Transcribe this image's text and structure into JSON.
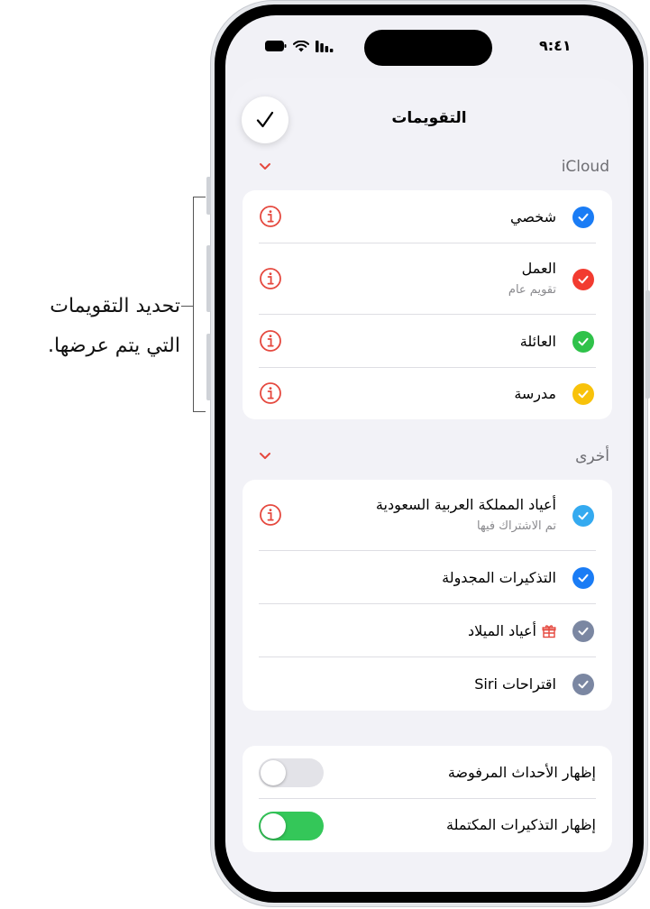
{
  "callout": {
    "line1": "تحديد التقويمات",
    "line2": "التي يتم عرضها."
  },
  "status_bar": {
    "time": "٩:٤١"
  },
  "sheet": {
    "title": "التقويمات",
    "done_icon": "checkmark-icon"
  },
  "sections": [
    {
      "header": "iCloud",
      "items": [
        {
          "title": "شخصي",
          "subtitle": "",
          "color": "#1a7cf5"
        },
        {
          "title": "العمل",
          "subtitle": "تقويم عام",
          "color": "#f23b30"
        },
        {
          "title": "العائلة",
          "subtitle": "",
          "color": "#2fc24a"
        },
        {
          "title": "مدرسة",
          "subtitle": "",
          "color": "#f8c20a"
        }
      ]
    },
    {
      "header": "أخرى",
      "items": [
        {
          "title": "أعياد المملكة العربية السعودية",
          "subtitle": "تم الاشتراك فيها",
          "color": "#34aaf0"
        },
        {
          "title": "التذكيرات المجدولة",
          "subtitle": "",
          "color": "#1a7cf5"
        },
        {
          "title": "أعياد الميلاد",
          "subtitle": "",
          "color": "#7b87a2"
        },
        {
          "title": "اقتراحات Siri",
          "subtitle": "",
          "color": "#7b87a2"
        }
      ]
    }
  ],
  "toggles": [
    {
      "label": "إظهار الأحداث المرفوضة",
      "on": false
    },
    {
      "label": "إظهار التذكيرات المكتملة",
      "on": true
    }
  ],
  "colors": {
    "accent_red": "#e5483e",
    "toggle_on": "#34c759",
    "toggle_off": "#e3e3e8"
  }
}
